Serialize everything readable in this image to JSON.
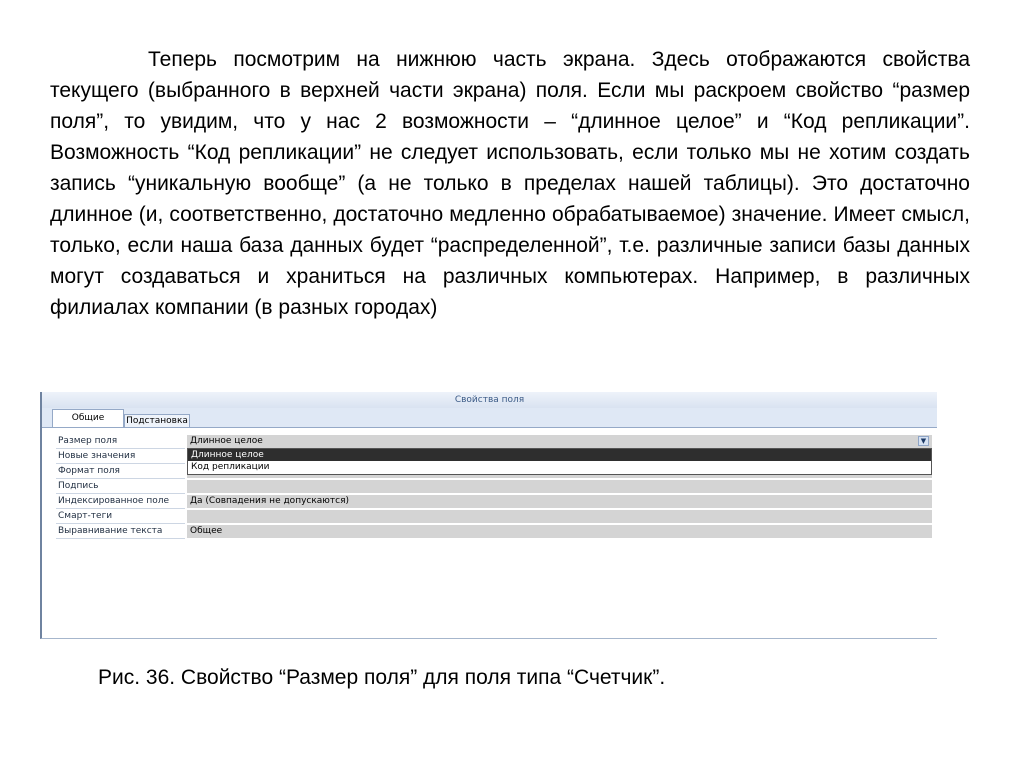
{
  "paragraph": "Теперь посмотрим на нижнюю часть экрана. Здесь отображаются свойства текущего  (выбранного в верхней части экрана) поля. Если мы раскроем свойство “размер поля”, то увидим, что у нас 2 возможности – “длинное целое” и “Код репликации”.  Возможность “Код репликации” не следует использовать, если только мы не хотим создать запись “уникальную вообще” (а не только в пределах нашей таблицы). Это достаточно длинное (и, соответственно, достаточно медленно обрабатываемое) значение. Имеет смысл, только, если наша база данных будет  “распределенной”, т.е. различные записи базы данных могут создаваться и храниться на различных компьютерах. Например, в различных филиалах компании (в разных городах)",
  "screenshot": {
    "header": "Свойства поля",
    "tabs": [
      "Общие",
      "Подстановка"
    ],
    "rows": [
      {
        "label": "Размер поля",
        "value": "Длинное целое"
      },
      {
        "label": "Новые значения",
        "value": ""
      },
      {
        "label": "Формат поля",
        "value": ""
      },
      {
        "label": "Подпись",
        "value": ""
      },
      {
        "label": "Индексированное поле",
        "value": "Да (Совпадения не допускаются)"
      },
      {
        "label": "Смарт-теги",
        "value": ""
      },
      {
        "label": "Выравнивание текста",
        "value": "Общее"
      }
    ],
    "dropdown_options": [
      "Длинное целое",
      "Код репликации"
    ],
    "dropdown_icon": "chevron-down-icon"
  },
  "caption": "Рис. 36. Свойство “Размер поля” для поля типа “Счетчик”."
}
